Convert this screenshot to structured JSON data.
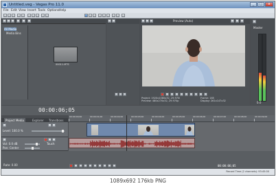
{
  "window": {
    "title": "Untitled.veg - Vegas Pro 11.0",
    "min": "_",
    "max": "□",
    "close": "x"
  },
  "menu": [
    "File",
    "Edit",
    "View",
    "Insert",
    "Tools",
    "Options",
    "Help"
  ],
  "explorer": {
    "tree": [
      "All Media",
      "Media Bins"
    ],
    "thumb_label": "00011.MTS",
    "tabs": [
      "Project Media",
      "Explorer",
      "Transitions",
      "Video FX",
      "Med"
    ]
  },
  "preview": {
    "mode": "Preview (Auto)",
    "info": {
      "project_label": "Project:",
      "project_value": "1920x1080x32, 29.970i",
      "preview_label": "Preview:",
      "preview_value": "480x270x32, 29.970p",
      "frame_label": "Frame:",
      "frame_value": "185",
      "display_label": "Display:",
      "display_value": "261x147x32"
    }
  },
  "master": {
    "label": "Master",
    "level": "0.0"
  },
  "timeline": {
    "timecode": "00:00:06;05",
    "ruler": [
      "00:00:00;00",
      "00:00:01;00",
      "00:00:02;00",
      "00:00:03;00",
      "00:00:04;00",
      "00:00:05;00",
      "00:00:06;00",
      "00:00:07;00",
      "00:00:08;00",
      "00:00:09;00"
    ],
    "video_track": {
      "level_label": "Level:",
      "level_value": "100.0 %"
    },
    "audio_track": {
      "vol_label": "Vol:",
      "vol_value": "0.0 dB",
      "pan_label": "Pan:",
      "pan_value": "Center",
      "touch": "Touch"
    }
  },
  "bottom": {
    "rate": "Rate: 0.00",
    "end_time": "00:00:06;05"
  },
  "status": {
    "text": "Record Time (2 channels): 93:45:00"
  },
  "caption": "1089x692  176kb  PNG",
  "colors": {
    "video_clip": "#7089ad",
    "audio_clip": "#b89c9c",
    "waveform": "#8b1f1f",
    "record": "#d12b1c"
  }
}
